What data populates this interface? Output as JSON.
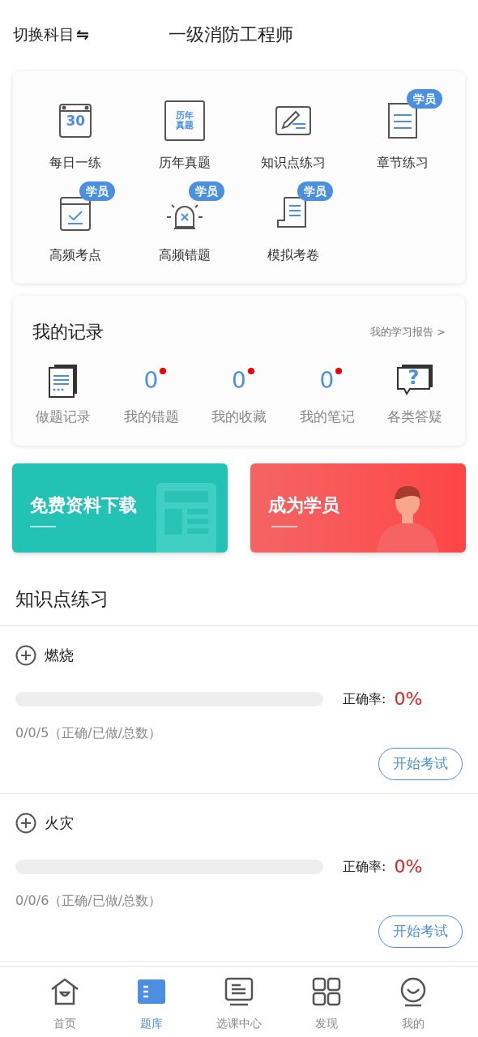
{
  "header": {
    "switch_label": "切换科目",
    "switch_icon": "⇋",
    "title": "一级消防工程师"
  },
  "features": [
    {
      "kind": "calendar",
      "label": "每日一练",
      "icon_text": "30"
    },
    {
      "kind": "paper",
      "label": "历年真题",
      "icon_text": "历年真题"
    },
    {
      "kind": "pencil",
      "label": "知识点练习"
    },
    {
      "kind": "doc",
      "label": "章节练习",
      "badge": "学员"
    },
    {
      "kind": "check",
      "label": "高频考点",
      "badge": "学员"
    },
    {
      "kind": "alarm",
      "label": "高频错题",
      "badge": "学员"
    },
    {
      "kind": "scroll",
      "label": "模拟考卷",
      "badge": "学员"
    }
  ],
  "records": {
    "title": "我的记录",
    "report_link": "我的学习报告 >",
    "items": [
      {
        "kind": "icon",
        "label": "做题记录"
      },
      {
        "kind": "count",
        "value": "0",
        "dot": true,
        "label": "我的错题"
      },
      {
        "kind": "count",
        "value": "0",
        "dot": true,
        "label": "我的收藏"
      },
      {
        "kind": "count",
        "value": "0",
        "dot": true,
        "label": "我的笔记"
      },
      {
        "kind": "question",
        "icon_text": "?",
        "label": "各类答疑"
      }
    ]
  },
  "banners": [
    {
      "kind": "download",
      "title": "免费资料下载"
    },
    {
      "kind": "member",
      "title": "成为学员"
    }
  ],
  "practice": {
    "title": "知识点练习",
    "items": [
      {
        "name": "燃烧",
        "level": 0,
        "accuracy_label": "正确率:",
        "accuracy": "0%",
        "stats": "0/0/5（正确/已做/总数）",
        "button": "开始考试"
      },
      {
        "name": "火灾",
        "level": 0,
        "accuracy_label": "正确率:",
        "accuracy": "0%",
        "stats": "0/0/6（正确/已做/总数）",
        "button": "开始考试"
      }
    ]
  },
  "tabs": [
    {
      "kind": "home",
      "label": "首页",
      "selected": false
    },
    {
      "kind": "bank",
      "label": "题库",
      "selected": true
    },
    {
      "kind": "course",
      "label": "选课中心",
      "selected": false
    },
    {
      "kind": "discover",
      "label": "发现",
      "selected": false
    },
    {
      "kind": "me",
      "label": "我的",
      "selected": false
    }
  ]
}
